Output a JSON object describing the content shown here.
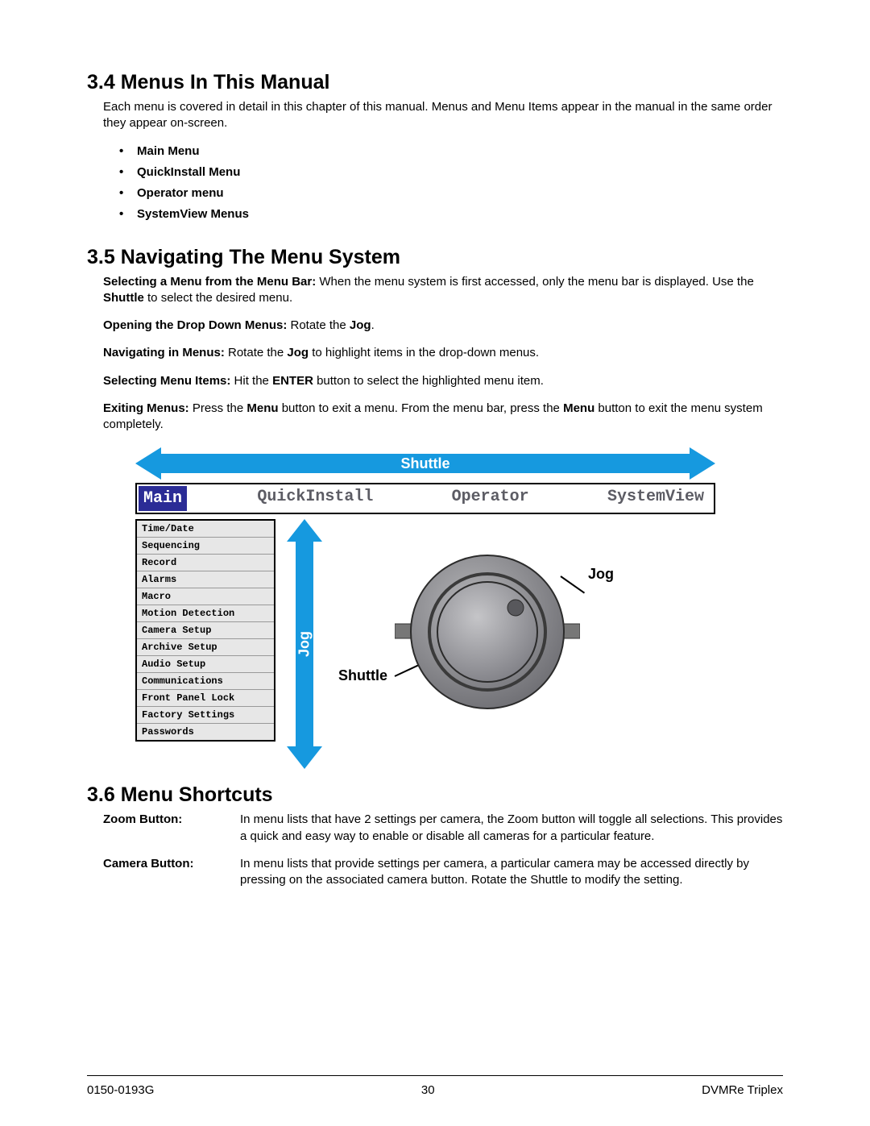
{
  "section34": {
    "heading": "3.4  Menus In This Manual",
    "intro": "Each menu is covered in detail in this chapter of this manual.  Menus and Menu Items appear in the manual in the same order they appear on-screen.",
    "bullets": [
      "Main Menu",
      "QuickInstall Menu",
      "Operator menu",
      "SystemView Menus"
    ]
  },
  "section35": {
    "heading": "3.5  Navigating The Menu System",
    "p1_bold": "Selecting a Menu from the Menu Bar:",
    "p1_a": "  When the menu system is first accessed, only the menu bar is displayed.  Use the ",
    "p1_shuttle": "Shuttle",
    "p1_b": " to select the desired menu.",
    "p2_bold": "Opening the Drop Down Menus:",
    "p2_a": "  Rotate the ",
    "p2_jog": "Jog",
    "p2_b": ".",
    "p3_bold": "Navigating in Menus:",
    "p3_a": "  Rotate the ",
    "p3_jog": "Jog",
    "p3_b": " to highlight items in the drop-down menus.",
    "p4_bold": "Selecting Menu Items:",
    "p4_a": "  Hit the ",
    "p4_enter": "ENTER",
    "p4_b": " button to select the highlighted menu item.",
    "p5_bold": "Exiting Menus:",
    "p5_a": "  Press the ",
    "p5_menu1": "Menu",
    "p5_b": " button to exit a menu.  From the menu bar, press the ",
    "p5_menu2": "Menu",
    "p5_c": " button to exit the menu system completely."
  },
  "diagram": {
    "shuttle_label": "Shuttle",
    "jog_vertical_label": "Jog",
    "tabs": [
      "Main",
      "QuickInstall",
      "Operator",
      "SystemView"
    ],
    "dropdown_items": [
      "Time/Date",
      "Sequencing",
      "Record",
      "Alarms",
      "Macro",
      "Motion Detection",
      "Camera Setup",
      "Archive Setup",
      "Audio Setup",
      "Communications",
      "Front Panel Lock",
      "Factory Settings",
      "Passwords"
    ],
    "dial_jog_label": "Jog",
    "dial_shuttle_label": "Shuttle"
  },
  "section36": {
    "heading": "3.6  Menu Shortcuts",
    "rows": [
      {
        "label": "Zoom Button:",
        "desc": "In menu lists that have 2 settings per camera, the Zoom button will toggle all selections. This provides a quick and easy way to enable or disable all cameras for a particular feature."
      },
      {
        "label": "Camera Button:",
        "desc": "In menu lists that provide settings per camera, a particular camera may be accessed directly by pressing on the associated camera button. Rotate the Shuttle to modify the setting."
      }
    ]
  },
  "footer": {
    "left": "0150-0193G",
    "center": "30",
    "right": "DVMRe Triplex"
  }
}
